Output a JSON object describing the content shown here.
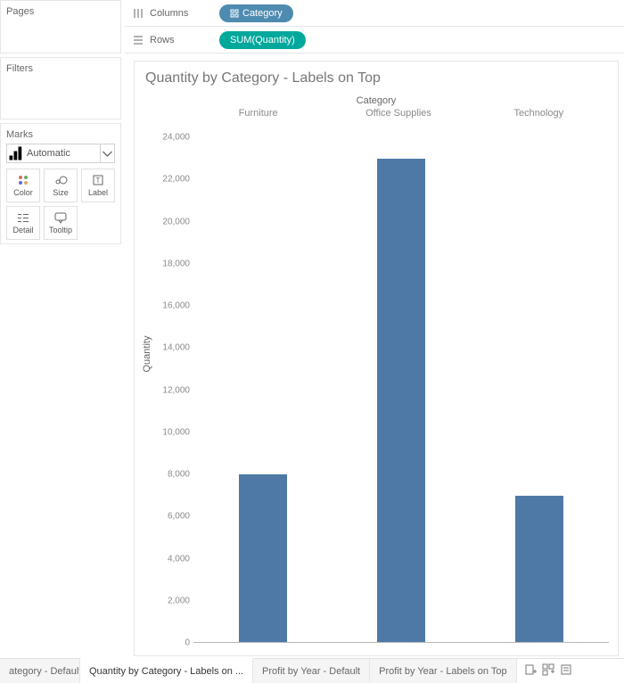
{
  "shelves": {
    "columns_label": "Columns",
    "rows_label": "Rows",
    "columns_pill": "Category",
    "rows_pill": "SUM(Quantity)"
  },
  "left": {
    "pages_title": "Pages",
    "filters_title": "Filters",
    "marks_title": "Marks",
    "marks_select": "Automatic",
    "cells": {
      "color": "Color",
      "size": "Size",
      "label": "Label",
      "detail": "Detail",
      "tooltip": "Tooltip"
    }
  },
  "viz": {
    "title": "Quantity by Category - Labels on Top",
    "field_header": "Category",
    "ylabel": "Quantity"
  },
  "ticks": {
    "t0": "0",
    "t1": "2,000",
    "t2": "4,000",
    "t3": "6,000",
    "t4": "8,000",
    "t5": "10,000",
    "t6": "12,000",
    "t7": "14,000",
    "t8": "16,000",
    "t9": "18,000",
    "t10": "20,000",
    "t11": "22,000",
    "t12": "24,000"
  },
  "cats": {
    "c0": "Furniture",
    "c1": "Office Supplies",
    "c2": "Technology"
  },
  "tabs": {
    "t0": "ategory - Default",
    "t1": "Quantity by Category - Labels on ...",
    "t2": "Profit by Year - Default",
    "t3": "Profit by Year - Labels on Top"
  },
  "chart_data": {
    "type": "bar",
    "title": "Quantity by Category - Labels on Top",
    "xlabel": "Category",
    "ylabel": "Quantity",
    "ylim": [
      0,
      24000
    ],
    "categories": [
      "Furniture",
      "Office Supplies",
      "Technology"
    ],
    "values": [
      8000,
      23000,
      7000
    ]
  }
}
